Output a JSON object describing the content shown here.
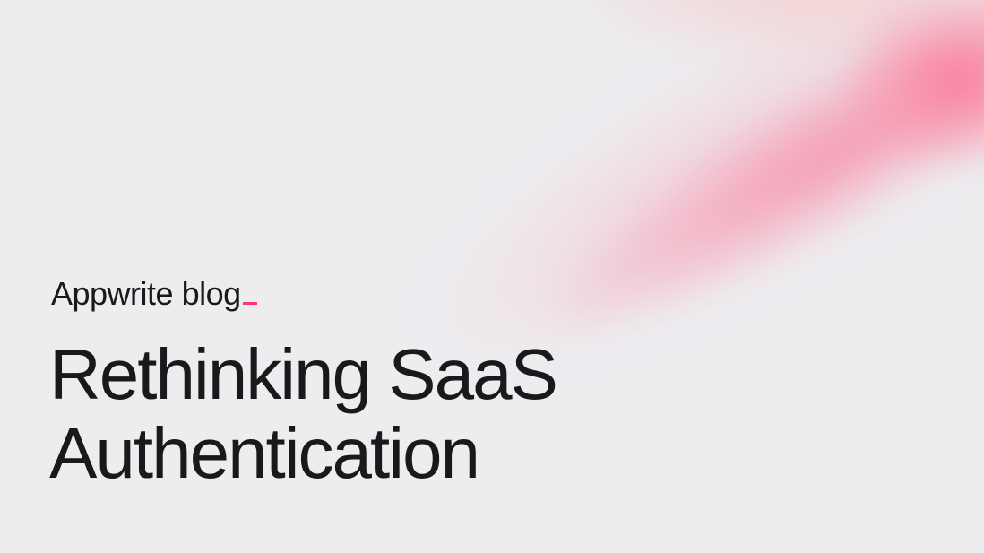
{
  "brand": {
    "label": "Appwrite blog",
    "cursor_color": "#fd366e"
  },
  "post": {
    "title_line_1": "Rethinking SaaS",
    "title_line_2": "Authentication"
  },
  "colors": {
    "background": "#ededf0",
    "text": "#19191c",
    "accent": "#fd366e",
    "glow": "#f88aa6"
  }
}
